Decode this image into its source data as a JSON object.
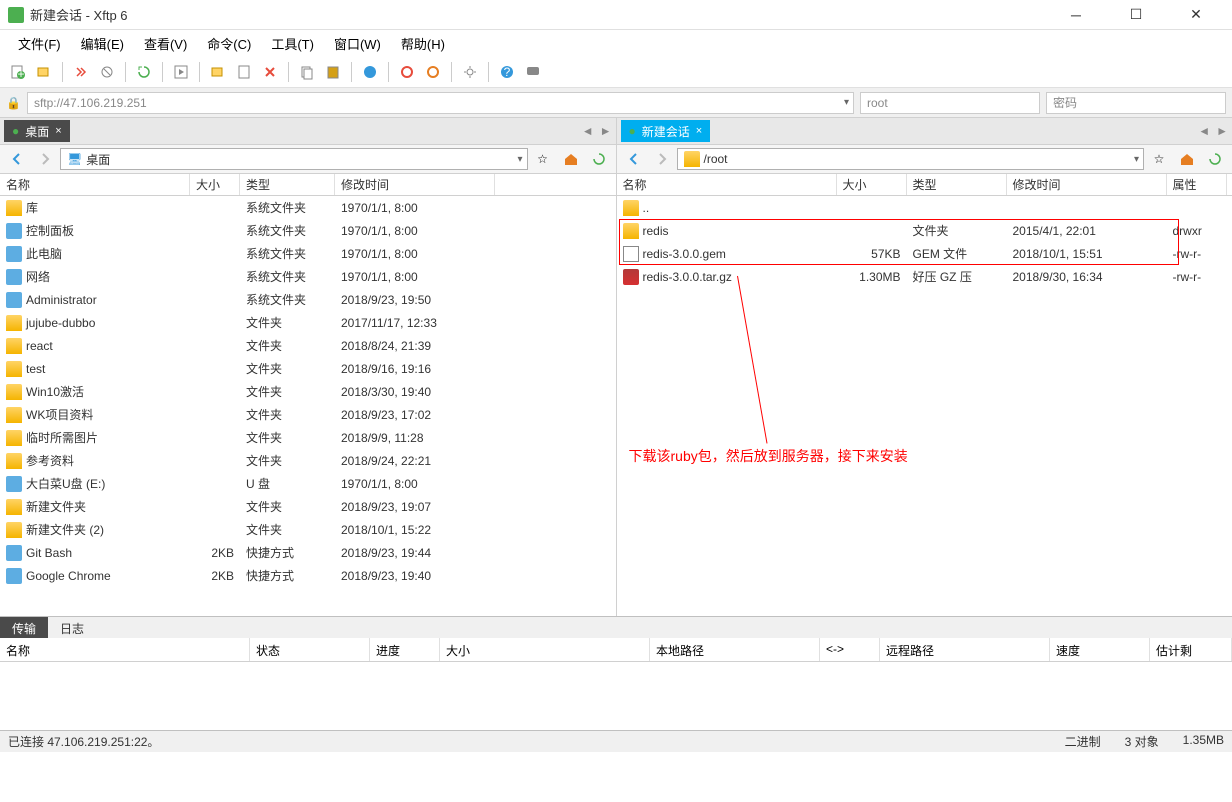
{
  "title": "新建会话   - Xftp 6",
  "menu": [
    "文件(F)",
    "编辑(E)",
    "查看(V)",
    "命令(C)",
    "工具(T)",
    "窗口(W)",
    "帮助(H)"
  ],
  "address": {
    "host": "sftp://47.106.219.251",
    "user": "root",
    "pass_placeholder": "密码"
  },
  "left": {
    "tab": "桌面",
    "path": "桌面",
    "columns": [
      "名称",
      "大小",
      "类型",
      "修改时间"
    ],
    "rows": [
      {
        "icon": "folder",
        "name": "库",
        "size": "",
        "type": "系统文件夹",
        "mtime": "1970/1/1, 8:00"
      },
      {
        "icon": "special",
        "name": "控制面板",
        "size": "",
        "type": "系统文件夹",
        "mtime": "1970/1/1, 8:00"
      },
      {
        "icon": "special",
        "name": "此电脑",
        "size": "",
        "type": "系统文件夹",
        "mtime": "1970/1/1, 8:00"
      },
      {
        "icon": "special",
        "name": "网络",
        "size": "",
        "type": "系统文件夹",
        "mtime": "1970/1/1, 8:00"
      },
      {
        "icon": "special",
        "name": "Administrator",
        "size": "",
        "type": "系统文件夹",
        "mtime": "2018/9/23, 19:50"
      },
      {
        "icon": "folder",
        "name": "jujube-dubbo",
        "size": "",
        "type": "文件夹",
        "mtime": "2017/11/17, 12:33"
      },
      {
        "icon": "folder",
        "name": "react",
        "size": "",
        "type": "文件夹",
        "mtime": "2018/8/24, 21:39"
      },
      {
        "icon": "folder",
        "name": "test",
        "size": "",
        "type": "文件夹",
        "mtime": "2018/9/16, 19:16"
      },
      {
        "icon": "folder",
        "name": "Win10激活",
        "size": "",
        "type": "文件夹",
        "mtime": "2018/3/30, 19:40"
      },
      {
        "icon": "folder",
        "name": "WK项目资料",
        "size": "",
        "type": "文件夹",
        "mtime": "2018/9/23, 17:02"
      },
      {
        "icon": "folder",
        "name": "临时所需图片",
        "size": "",
        "type": "文件夹",
        "mtime": "2018/9/9, 11:28"
      },
      {
        "icon": "folder",
        "name": "参考资料",
        "size": "",
        "type": "文件夹",
        "mtime": "2018/9/24, 22:21"
      },
      {
        "icon": "special",
        "name": "大白菜U盘 (E:)",
        "size": "",
        "type": "U 盘",
        "mtime": "1970/1/1, 8:00"
      },
      {
        "icon": "folder",
        "name": "新建文件夹",
        "size": "",
        "type": "文件夹",
        "mtime": "2018/9/23, 19:07"
      },
      {
        "icon": "folder",
        "name": "新建文件夹 (2)",
        "size": "",
        "type": "文件夹",
        "mtime": "2018/10/1, 15:22"
      },
      {
        "icon": "special",
        "name": "Git Bash",
        "size": "2KB",
        "type": "快捷方式",
        "mtime": "2018/9/23, 19:44"
      },
      {
        "icon": "special",
        "name": "Google Chrome",
        "size": "2KB",
        "type": "快捷方式",
        "mtime": "2018/9/23, 19:40"
      }
    ]
  },
  "right": {
    "tab": "新建会话",
    "path": "/root",
    "columns": [
      "名称",
      "大小",
      "类型",
      "修改时间",
      "属性"
    ],
    "rows": [
      {
        "icon": "folder",
        "name": "..",
        "size": "",
        "type": "",
        "mtime": "",
        "attr": ""
      },
      {
        "icon": "folder",
        "name": "redis",
        "size": "",
        "type": "文件夹",
        "mtime": "2015/4/1, 22:01",
        "attr": "drwxr"
      },
      {
        "icon": "file",
        "name": "redis-3.0.0.gem",
        "size": "57KB",
        "type": "GEM 文件",
        "mtime": "2018/10/1, 15:51",
        "attr": "-rw-r-"
      },
      {
        "icon": "archive",
        "name": "redis-3.0.0.tar.gz",
        "size": "1.30MB",
        "type": "好压 GZ 压",
        "mtime": "2018/9/30, 16:34",
        "attr": "-rw-r-"
      }
    ],
    "annotation": "下载该ruby包，然后放到服务器，接下来安装"
  },
  "transfer_tabs": [
    "传输",
    "日志"
  ],
  "transfer_columns": [
    "名称",
    "状态",
    "进度",
    "大小",
    "本地路径",
    "<->",
    "远程路径",
    "速度",
    "估计剩"
  ],
  "status": {
    "left": "已连接 47.106.219.251:22。",
    "mid": "二进制",
    "objects": "3 对象",
    "size": "1.35MB"
  }
}
